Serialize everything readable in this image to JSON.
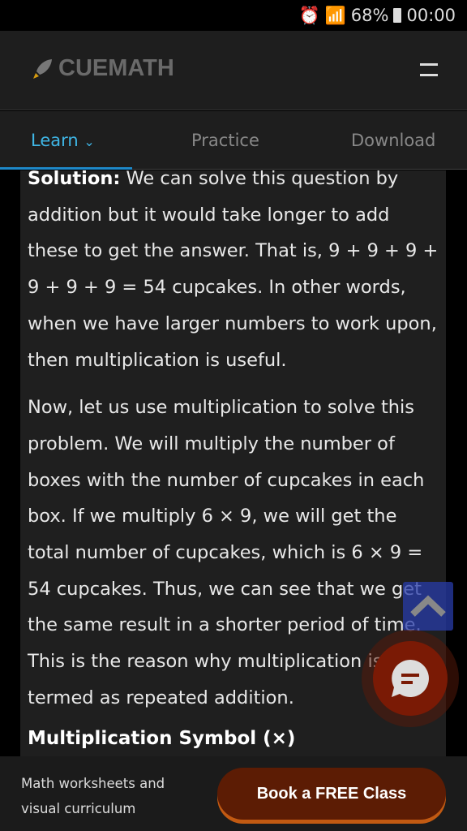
{
  "status_bar": {
    "battery": "68%",
    "time": "00:00"
  },
  "header": {
    "logo": "CUEMATH"
  },
  "tabs": [
    {
      "label": "Learn"
    },
    {
      "label": "Practice"
    },
    {
      "label": "Download"
    }
  ],
  "content": {
    "p1_label": "Solution:",
    "p1": " We can solve this question by addition but it would take longer to add these to get the answer. That is, 9 + 9 + 9 + 9 + 9 + 9 = 54 cupcakes. In other words, when we have larger numbers to work upon, then multiplication is useful.",
    "p2": "Now, let us use multiplication to solve this problem. We will multiply the number of boxes with the number of cupcakes in each box. If we multiply 6 × 9, we will get the total number of cupcakes, which is 6 × 9 = 54 cupcakes. Thus, we can see that we get the same result in a shorter period of time. This is the reason why multiplication is also termed as repeated addition.",
    "heading": "Multiplication Symbol (×)"
  },
  "bottom_bar": {
    "line1": "Math worksheets and",
    "line2": "visual curriculum",
    "cta": "Book a FREE Class"
  }
}
